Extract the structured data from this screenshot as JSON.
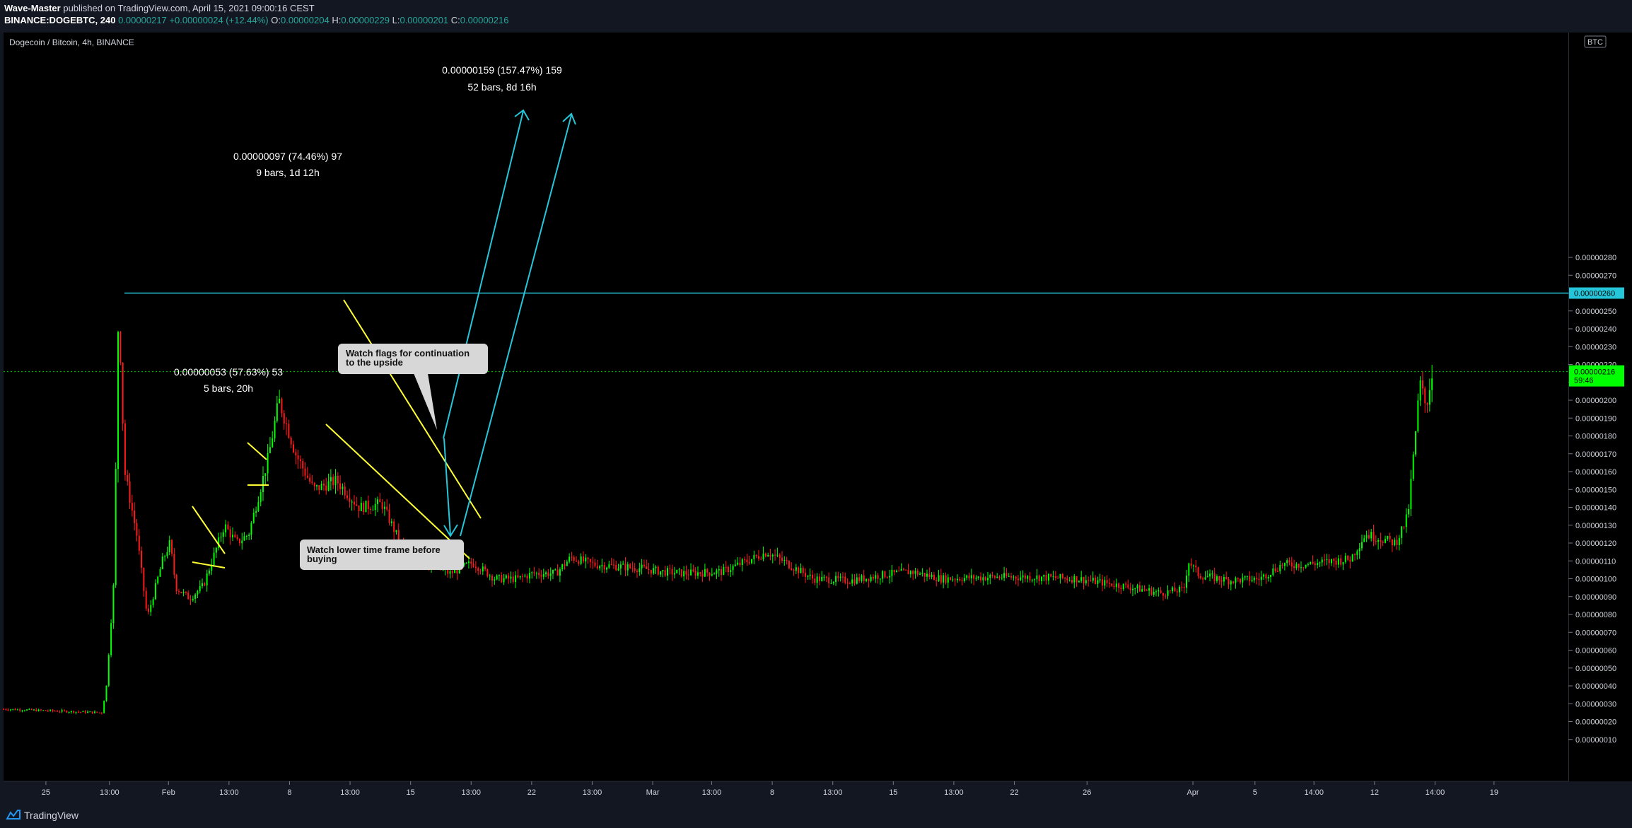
{
  "header": {
    "author": "Wave-Master",
    "published_text": "published on TradingView.com, April 15, 2021 09:00:16 CEST",
    "symbol": "BINANCE:DOGEBTC, 240",
    "last_price": "0.00000217",
    "change": "+0.00000024 (+12.44%)",
    "o_label": "O:",
    "o_val": "0.00000204",
    "h_label": "H:",
    "h_val": "0.00000229",
    "l_label": "L:",
    "l_val": "0.00000201",
    "c_label": "C:",
    "c_val": "0.00000216"
  },
  "footer": {
    "brand": "TradingView"
  },
  "colors": {
    "up": "#00ff00",
    "down": "#ff1a1a",
    "hline": "#26c6da",
    "annotation": "#ffff33",
    "price_badge": "#00ff00"
  },
  "chart_data": {
    "type": "candlestick",
    "title": "Dogecoin / Bitcoin, 4h, BINANCE",
    "currency_label": "BTC",
    "ylim": [
      0.0,
      2.8e-06
    ],
    "y_ticks": [
      "0.00000010",
      "0.00000020",
      "0.00000030",
      "0.00000040",
      "0.00000050",
      "0.00000060",
      "0.00000070",
      "0.00000080",
      "0.00000090",
      "0.00000100",
      "0.00000110",
      "0.00000120",
      "0.00000130",
      "0.00000140",
      "0.00000150",
      "0.00000160",
      "0.00000170",
      "0.00000180",
      "0.00000190",
      "0.00000200",
      "0.00000210",
      "0.00000220",
      "0.00000230",
      "0.00000240",
      "0.00000250",
      "0.00000260",
      "0.00000270",
      "0.00000280"
    ],
    "x_ticks": [
      "25",
      "13:00",
      "Feb",
      "13:00",
      "8",
      "13:00",
      "15",
      "13:00",
      "22",
      "13:00",
      "Mar",
      "13:00",
      "8",
      "13:00",
      "15",
      "13:00",
      "22",
      "26",
      "Apr",
      "5",
      "14:00",
      "12",
      "14:00",
      "19"
    ],
    "x_domain": [
      0,
      100
    ],
    "x_tick_positions": [
      2.8,
      7.0,
      10.9,
      14.9,
      18.9,
      22.9,
      26.9,
      30.9,
      34.9,
      38.9,
      42.9,
      46.8,
      50.8,
      54.8,
      58.8,
      62.8,
      66.8,
      71.6,
      78.6,
      82.7,
      86.6,
      90.6,
      94.6,
      98.5
    ],
    "horizontal_line": {
      "value": 2.6e-06,
      "label": "0.00000260"
    },
    "last_price_line": {
      "value": 2.16e-06,
      "label": "0.00000216",
      "countdown": "59:46"
    },
    "path": [
      [
        0,
        27
      ],
      [
        6.5,
        25
      ],
      [
        6.8,
        40
      ],
      [
        7.3,
        100
      ],
      [
        7.6,
        255
      ],
      [
        8.0,
        160
      ],
      [
        8.8,
        125
      ],
      [
        9.5,
        78
      ],
      [
        10.5,
        110
      ],
      [
        11.0,
        120
      ],
      [
        11.4,
        95
      ],
      [
        12.3,
        89
      ],
      [
        13.2,
        96
      ],
      [
        14.6,
        130
      ],
      [
        15.4,
        120
      ],
      [
        16.2,
        125
      ],
      [
        17.5,
        168
      ],
      [
        18.2,
        200
      ],
      [
        19.3,
        170
      ],
      [
        20.5,
        150
      ],
      [
        22.0,
        155
      ],
      [
        23.5,
        140
      ],
      [
        25.0,
        142
      ],
      [
        26.5,
        115
      ],
      [
        28.0,
        108
      ],
      [
        29.5,
        103
      ],
      [
        31.0,
        109
      ],
      [
        32.5,
        100
      ],
      [
        34.0,
        100
      ],
      [
        35.0,
        103
      ],
      [
        36.5,
        103
      ],
      [
        37.5,
        112
      ],
      [
        39.0,
        108
      ],
      [
        42.0,
        106
      ],
      [
        43.5,
        104
      ],
      [
        45.0,
        103
      ],
      [
        47.5,
        104
      ],
      [
        50.5,
        115
      ],
      [
        51.5,
        110
      ],
      [
        53.5,
        100
      ],
      [
        56.0,
        99
      ],
      [
        58.0,
        102
      ],
      [
        60.0,
        104
      ],
      [
        62.0,
        100
      ],
      [
        65.5,
        101
      ],
      [
        68.0,
        101
      ],
      [
        71.0,
        100
      ],
      [
        74.0,
        96
      ],
      [
        76.5,
        92
      ],
      [
        78.0,
        94
      ],
      [
        78.3,
        110
      ],
      [
        79.0,
        102
      ],
      [
        81.0,
        99
      ],
      [
        83.0,
        100
      ],
      [
        84.5,
        108
      ],
      [
        86.0,
        108
      ],
      [
        89.0,
        111
      ],
      [
        90.0,
        125
      ],
      [
        92.0,
        120
      ],
      [
        92.8,
        135
      ],
      [
        93.3,
        180
      ],
      [
        93.6,
        210
      ],
      [
        94.0,
        196
      ],
      [
        94.4,
        215
      ]
    ],
    "annotations": {
      "measure1": {
        "line1": "0.00000053 (57.63%) 53",
        "line2": "5 bars, 20h"
      },
      "measure2": {
        "line1": "0.00000097 (74.46%) 97",
        "line2": "9 bars, 1d 12h"
      },
      "measure3": {
        "line1": "0.00000159 (157.47%) 159",
        "line2": "52 bars, 8d 16h"
      },
      "callout1": {
        "line1": "Watch flags for continuation",
        "line2": "to the upside"
      },
      "callout2": {
        "line1": "Watch lower time frame before",
        "line2": "buying"
      }
    }
  }
}
